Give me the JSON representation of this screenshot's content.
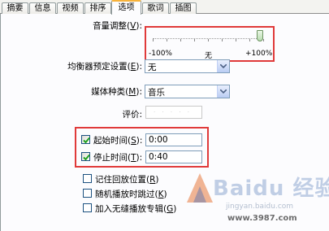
{
  "tabs": [
    {
      "label": "摘要",
      "active": false
    },
    {
      "label": "信息",
      "active": false
    },
    {
      "label": "视频",
      "active": false
    },
    {
      "label": "排序",
      "active": false
    },
    {
      "label": "选项",
      "active": true
    },
    {
      "label": "歌词",
      "active": false
    },
    {
      "label": "插图",
      "active": false
    }
  ],
  "volume": {
    "label_prefix": "音量调整(",
    "label_key": "V",
    "label_suffix": "):",
    "scale_min": "-100%",
    "scale_mid": "无",
    "scale_max": "+100%",
    "value_percent": 100
  },
  "equalizer": {
    "label_prefix": "均衡器预定设置(",
    "label_key": "E",
    "label_suffix": "):",
    "value": "无"
  },
  "media_kind": {
    "label_prefix": "媒体种类(",
    "label_key": "M",
    "label_suffix": "):",
    "value": "音乐"
  },
  "rating": {
    "label": "评价:",
    "dots": "· · · · ·"
  },
  "start_time": {
    "label_prefix": "起始时间(",
    "label_key": "S",
    "label_suffix": "):",
    "checked": true,
    "value": "0:00"
  },
  "stop_time": {
    "label_prefix": "停止时间(",
    "label_key": "T",
    "label_suffix": "):",
    "checked": true,
    "value": "0:40"
  },
  "options": [
    {
      "label_prefix": "记住回放位置(",
      "label_key": "R",
      "label_suffix": ")",
      "checked": false
    },
    {
      "label_prefix": "随机播放时跳过(",
      "label_key": "K",
      "label_suffix": ")",
      "checked": false
    },
    {
      "label_prefix": "加入无缝播放专辑(",
      "label_key": "G",
      "label_suffix": ")",
      "checked": false
    }
  ],
  "watermark": {
    "main": "Baidu 经验站",
    "sub": "jingyan.baidu.com",
    "url": "www.3987.com"
  },
  "colors": {
    "highlight_border": "#e03a3a",
    "active_tab_accent": "#f7b23b",
    "field_border": "#7f9db9"
  }
}
